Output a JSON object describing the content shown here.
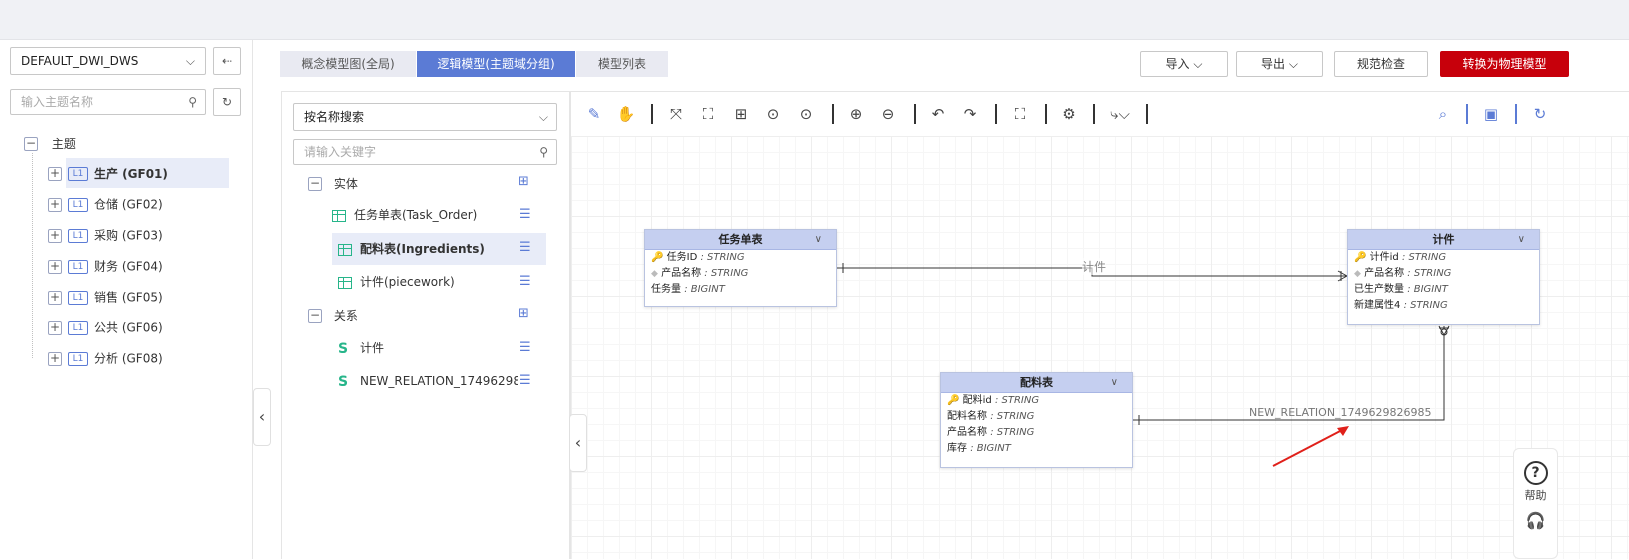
{
  "workspace": {
    "selected": "DEFAULT_DWI_DWS"
  },
  "left_search": {
    "placeholder": "输入主题名称"
  },
  "tree": {
    "root_label": "主题",
    "items": [
      {
        "badge": "L1",
        "label": "生产 (GF01)"
      },
      {
        "badge": "L1",
        "label": "仓储 (GF02)"
      },
      {
        "badge": "L1",
        "label": "采购 (GF03)"
      },
      {
        "badge": "L1",
        "label": "财务 (GF04)"
      },
      {
        "badge": "L1",
        "label": "销售 (GF05)"
      },
      {
        "badge": "L1",
        "label": "公共 (GF06)"
      },
      {
        "badge": "L1",
        "label": "分析 (GF08)"
      }
    ]
  },
  "tabs": [
    "概念模型图(全局)",
    "逻辑模型(主题域分组)",
    "模型列表"
  ],
  "top_buttons": {
    "import": "导入",
    "export": "导出",
    "check": "规范检查",
    "convert": "转换为物理模型"
  },
  "mid": {
    "search_mode": "按名称搜索",
    "keyword_placeholder": "请输入关键字",
    "entity_group": "实体",
    "entities": [
      "任务单表(Task_Order)",
      "配料表(Ingredients)",
      "计件(piecework)"
    ],
    "relation_group": "关系",
    "relations": [
      "计件",
      "NEW_RELATION_17496298…"
    ]
  },
  "canvas": {
    "entities": {
      "task": {
        "title": "任务单表",
        "fields": [
          {
            "name": "任务ID",
            "type": ": STRING",
            "marker": "key"
          },
          {
            "name": "产品名称",
            "type": ": STRING",
            "marker": "diamond"
          },
          {
            "name": "任务量",
            "type": ": BIGINT",
            "marker": ""
          }
        ]
      },
      "piece": {
        "title": "计件",
        "fields": [
          {
            "name": "计件id",
            "type": ": STRING",
            "marker": "key"
          },
          {
            "name": "产品名称",
            "type": ": STRING",
            "marker": "diamond"
          },
          {
            "name": "已生产数量",
            "type": ": BIGINT",
            "marker": ""
          },
          {
            "name": "新建属性4",
            "type": ": STRING",
            "marker": ""
          }
        ]
      },
      "ingr": {
        "title": "配料表",
        "fields": [
          {
            "name": "配料id",
            "type": ": STRING",
            "marker": "key"
          },
          {
            "name": "配料名称",
            "type": ": STRING",
            "marker": ""
          },
          {
            "name": "产品名称",
            "type": ": STRING",
            "marker": ""
          },
          {
            "name": "库存",
            "type": ": BIGINT",
            "marker": ""
          }
        ]
      }
    },
    "relation_labels": {
      "piecework": "计件",
      "new_relation": "NEW_RELATION_1749629826985"
    }
  },
  "help": {
    "label": "帮助"
  },
  "colors": {
    "accent": "#5b7bd5",
    "danger": "#c7000b",
    "entity_header": "#c5cff0",
    "table_icon": "#27b58a"
  }
}
